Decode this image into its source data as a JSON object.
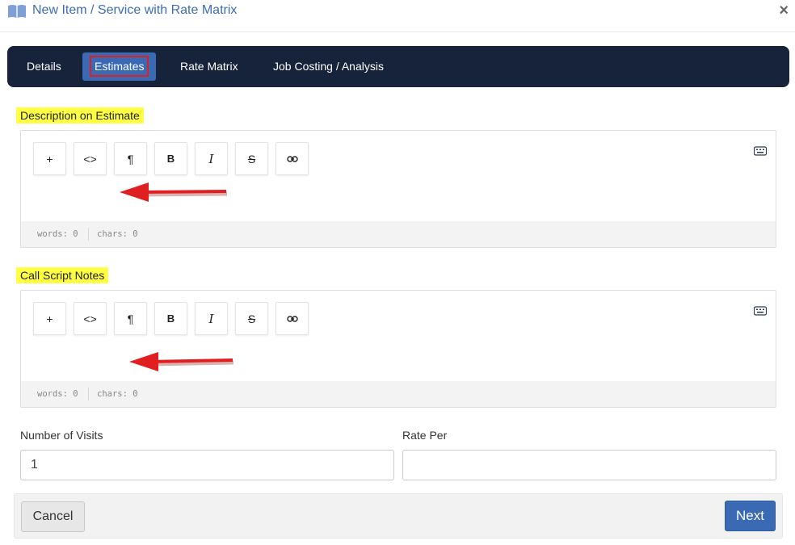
{
  "dialog": {
    "title": "New Item / Service with Rate Matrix",
    "close_symbol": "×"
  },
  "tabs": [
    {
      "label": "Details",
      "active": false
    },
    {
      "label": "Estimates",
      "active": true
    },
    {
      "label": "Rate Matrix",
      "active": false
    },
    {
      "label": "Job Costing / Analysis",
      "active": false
    }
  ],
  "description_editor": {
    "label": "Description on Estimate",
    "toolbar": [
      {
        "icon": "plus-icon",
        "glyph": "+"
      },
      {
        "icon": "code-icon",
        "glyph": "<>"
      },
      {
        "icon": "paragraph-icon",
        "glyph": "¶"
      },
      {
        "icon": "bold-icon",
        "glyph": "B"
      },
      {
        "icon": "italic-icon",
        "glyph": "I"
      },
      {
        "icon": "strikethrough-icon",
        "glyph": "S"
      },
      {
        "icon": "link-icon",
        "glyph": ""
      }
    ],
    "words": "words: 0",
    "chars": "chars: 0"
  },
  "call_script_editor": {
    "label": "Call Script Notes",
    "toolbar": [
      {
        "icon": "plus-icon",
        "glyph": "+"
      },
      {
        "icon": "code-icon",
        "glyph": "<>"
      },
      {
        "icon": "paragraph-icon",
        "glyph": "¶"
      },
      {
        "icon": "bold-icon",
        "glyph": "B"
      },
      {
        "icon": "italic-icon",
        "glyph": "I"
      },
      {
        "icon": "strikethrough-icon",
        "glyph": "S"
      },
      {
        "icon": "link-icon",
        "glyph": ""
      }
    ],
    "words": "words: 0",
    "chars": "chars: 0"
  },
  "fields": {
    "visits_label": "Number of Visits",
    "visits_value": "1",
    "rate_label": "Rate Per",
    "rate_value": ""
  },
  "footer": {
    "cancel_label": "Cancel",
    "next_label": "Next"
  },
  "colors": {
    "accent": "#3b6ab5",
    "tabbar": "#17223b",
    "highlight": "#ffff44",
    "annotation": "#e02020"
  }
}
